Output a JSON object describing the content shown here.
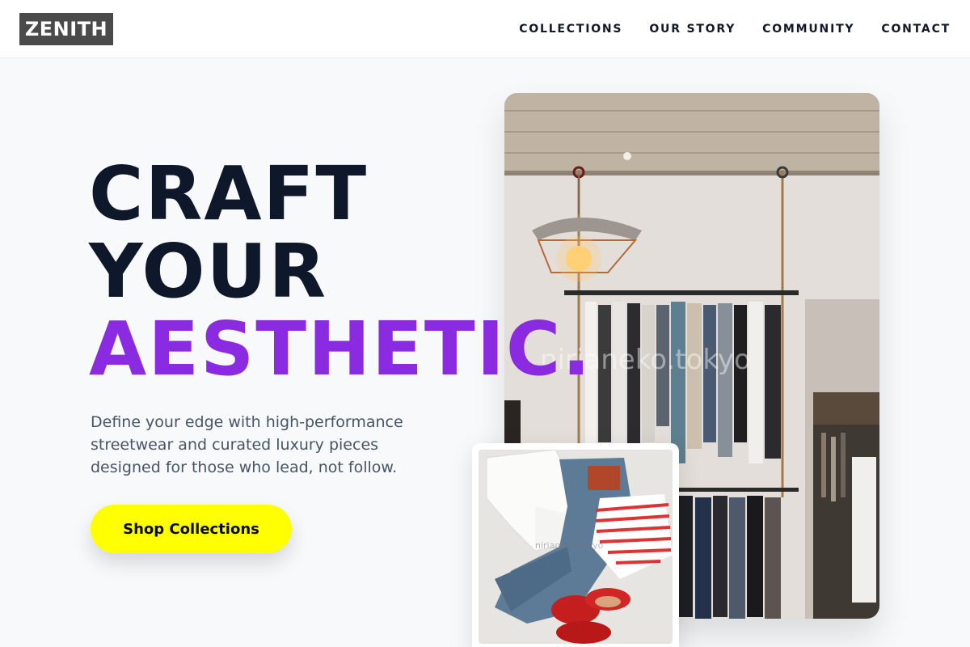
{
  "brand": {
    "logo": "ZENITH"
  },
  "nav": {
    "items": [
      {
        "label": "COLLECTIONS"
      },
      {
        "label": "OUR STORY"
      },
      {
        "label": "COMMUNITY"
      },
      {
        "label": "CONTACT"
      }
    ]
  },
  "hero": {
    "headline_line1": "CRAFT",
    "headline_line2": "YOUR",
    "headline_line3": "AESTHETIC.",
    "subcopy": "Define your edge with high-performance streetwear and curated luxury pieces designed for those who lead, not follow.",
    "cta_label": "Shop Collections"
  },
  "images": {
    "main_watermark": "nirianeko.tokyo",
    "thumb_watermark": "nirianeko.tokyo"
  },
  "colors": {
    "accent": "#8a2be2",
    "cta": "#ffff00",
    "headline": "#0f172a",
    "logo_bg": "#4a4a4a"
  }
}
